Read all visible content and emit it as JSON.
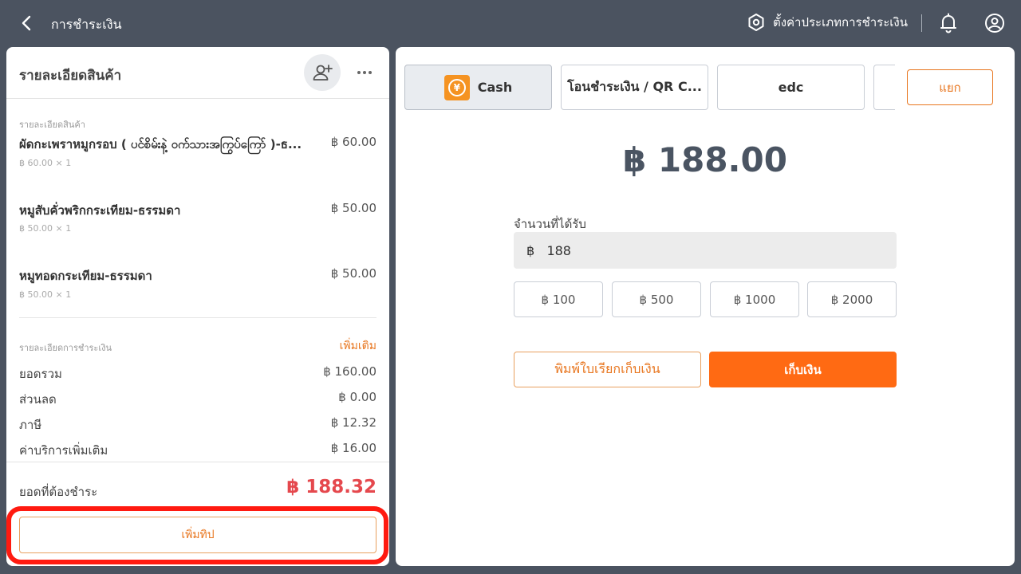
{
  "header": {
    "title": "การชำระเงิน",
    "settings_label": "ตั้งค่าประเภทการชำระเงิน"
  },
  "order": {
    "title": "รายละเอียดสินค้า",
    "items_caption": "รายละเอียดสินค้า",
    "items": [
      {
        "name": "ผัดกะเพราหมูกรอบ ( ပင်စိမ်းနဲ့ ဝက်သားအကြွပ်ကြော် )-ธ...",
        "price": "฿ 60.00",
        "qty": "฿ 60.00 × 1"
      },
      {
        "name": "หมูสับคั่วพริกกระเทียม-ธรรมดา",
        "price": "฿ 50.00",
        "qty": "฿ 50.00 × 1"
      },
      {
        "name": "หมูทอดกระเทียม-ธรรมดา",
        "price": "฿ 50.00",
        "qty": "฿ 50.00 × 1"
      }
    ],
    "payment_caption": "รายละเอียดการชำระเงิน",
    "add_more": "เพิ่มเติม",
    "summary": [
      {
        "label": "ยอดรวม",
        "value": "฿ 160.00"
      },
      {
        "label": "ส่วนลด",
        "value": "฿ 0.00"
      },
      {
        "label": "ภาษี",
        "value": "฿ 12.32"
      },
      {
        "label": "ค่าบริการเพิ่มเติม",
        "value": "฿ 16.00"
      }
    ],
    "due_label": "ยอดที่ต้องชำระ",
    "due_value": "฿ 188.32",
    "tip_button": "เพิ่มทิป"
  },
  "payment": {
    "methods": [
      {
        "label": "Cash",
        "icon": "cash-yen-icon",
        "active": true
      },
      {
        "label": "โอนชำระเงิน / QR C...",
        "active": false
      },
      {
        "label": "edc",
        "active": false
      },
      {
        "label": "",
        "active": false
      }
    ],
    "split_button": "แยก",
    "amount": "฿ 188.00",
    "received_label": "จำนวนที่ได้รับ",
    "received_value": "฿   188",
    "quick_amounts": [
      "฿ 100",
      "฿ 500",
      "฿ 1000",
      "฿ 2000"
    ],
    "print_button": "พิมพ์ใบเรียกเก็บเงิน",
    "collect_button": "เก็บเงิน"
  },
  "annotation": {
    "highlight_color": "#ff1a10",
    "arrow_color": "#ff1a10"
  },
  "colors": {
    "accent": "#ff6a13",
    "due": "#e5484d",
    "topbar": "#4b5360"
  }
}
